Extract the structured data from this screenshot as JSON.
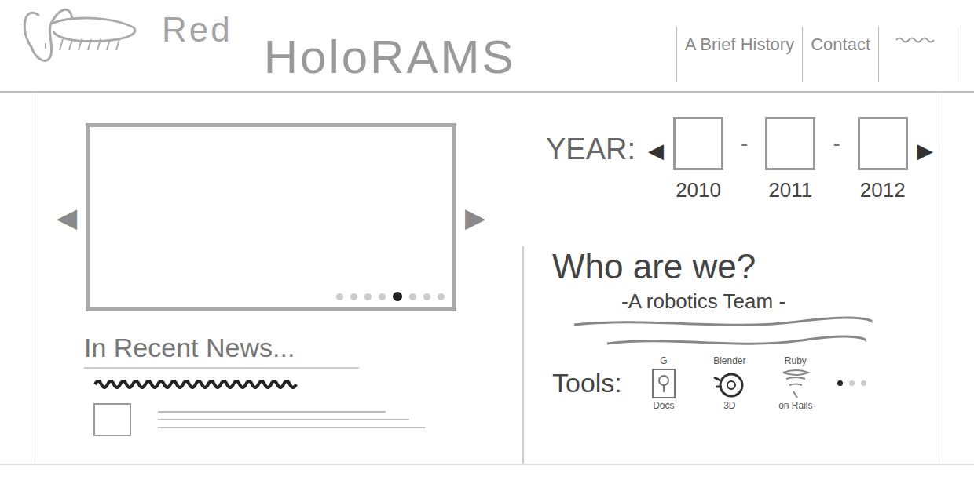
{
  "logo": {
    "words": [
      "Red",
      "HoloRAMS"
    ]
  },
  "nav": {
    "items": [
      {
        "kind": "link",
        "label": "A Brief History"
      },
      {
        "kind": "link",
        "label": "Contact"
      },
      {
        "kind": "squiggle",
        "label": ""
      }
    ]
  },
  "slideshow": {
    "prev": "◀",
    "next": "▶",
    "dots": [
      {
        "selected": false
      },
      {
        "selected": false
      },
      {
        "selected": false
      },
      {
        "selected": false
      },
      {
        "selected": true
      },
      {
        "selected": false
      },
      {
        "selected": false
      },
      {
        "selected": false
      }
    ]
  },
  "news": {
    "title": "In Recent News..."
  },
  "years": {
    "label": "YEAR:",
    "prev": "◀",
    "next": "▶",
    "separator": "-",
    "items": [
      {
        "label": "2010"
      },
      {
        "label": "2011"
      },
      {
        "label": "2012"
      }
    ]
  },
  "about": {
    "title": "Who are we?",
    "subtitle": "-A robotics Team -"
  },
  "tools": {
    "label": "Tools:",
    "items": [
      {
        "top": "G",
        "bottom": "Docs",
        "kind": "docs"
      },
      {
        "top": "Blender",
        "bottom": "3D",
        "kind": "blender"
      },
      {
        "top": "Ruby",
        "bottom": "on Rails",
        "kind": "rails"
      }
    ],
    "dots": [
      {
        "selected": true
      },
      {
        "selected": false
      },
      {
        "selected": false
      }
    ]
  }
}
